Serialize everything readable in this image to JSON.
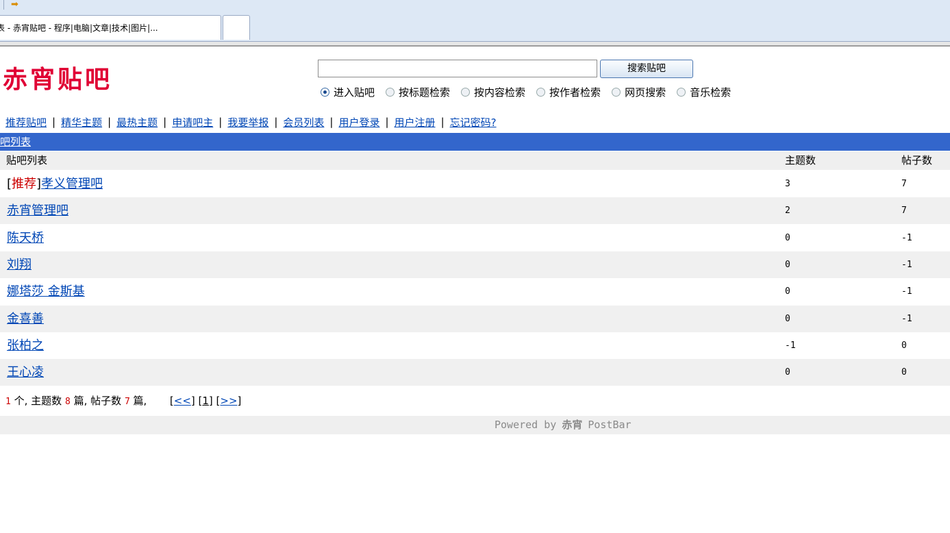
{
  "browser": {
    "active_tab_title": "表 - 赤宵贴吧 - 程序|电脑|文章|技术|图片|..."
  },
  "header": {
    "logo_text": "赤宵贴吧",
    "search_value": "",
    "search_button": "搜索贴吧",
    "search_modes": [
      {
        "label": "进入贴吧",
        "checked": true
      },
      {
        "label": "按标题检索",
        "checked": false
      },
      {
        "label": "按内容检索",
        "checked": false
      },
      {
        "label": "按作者检索",
        "checked": false
      },
      {
        "label": "网页搜索",
        "checked": false
      },
      {
        "label": "音乐检索",
        "checked": false
      }
    ]
  },
  "nav": {
    "items": [
      "推荐贴吧",
      "精华主题",
      "最热主题",
      "申请吧主",
      "我要举报",
      "会员列表",
      "用户登录",
      "用户注册",
      "忘记密码?"
    ],
    "separator": "|"
  },
  "list_title": "吧列表",
  "columns": {
    "name": "贴吧列表",
    "topics": "主题数",
    "posts": "帖子数"
  },
  "rows": [
    {
      "tag_open": "[",
      "tag": "推荐",
      "tag_close": "]",
      "name": "孝义管理吧",
      "topics": "3",
      "posts": "7"
    },
    {
      "name": "赤宵管理吧",
      "topics": "2",
      "posts": "7"
    },
    {
      "name": "陈天桥",
      "topics": "0",
      "posts": "-1"
    },
    {
      "name": "刘翔",
      "topics": "0",
      "posts": "-1"
    },
    {
      "name": "娜塔莎 金斯基",
      "topics": "0",
      "posts": "-1"
    },
    {
      "name": "金喜善",
      "topics": "0",
      "posts": "-1"
    },
    {
      "name": "张柏之",
      "topics": "-1",
      "posts": "0"
    },
    {
      "name": "王心凌",
      "topics": "0",
      "posts": "0"
    }
  ],
  "summary": {
    "count": "1",
    "count_suffix": "个,",
    "topics_label": "主题数",
    "topics": "8",
    "topics_unit": "篇,",
    "posts_label": "帖子数",
    "posts": "7",
    "posts_unit": "篇,",
    "prev": "<<",
    "page": "1",
    "next": ">>"
  },
  "footer": {
    "powered_by": "Powered by",
    "brand": "赤宵",
    "product": "PostBar"
  },
  "colors": {
    "accent": "#3366cc",
    "logo": "#e00035",
    "link": "#0046b5"
  }
}
